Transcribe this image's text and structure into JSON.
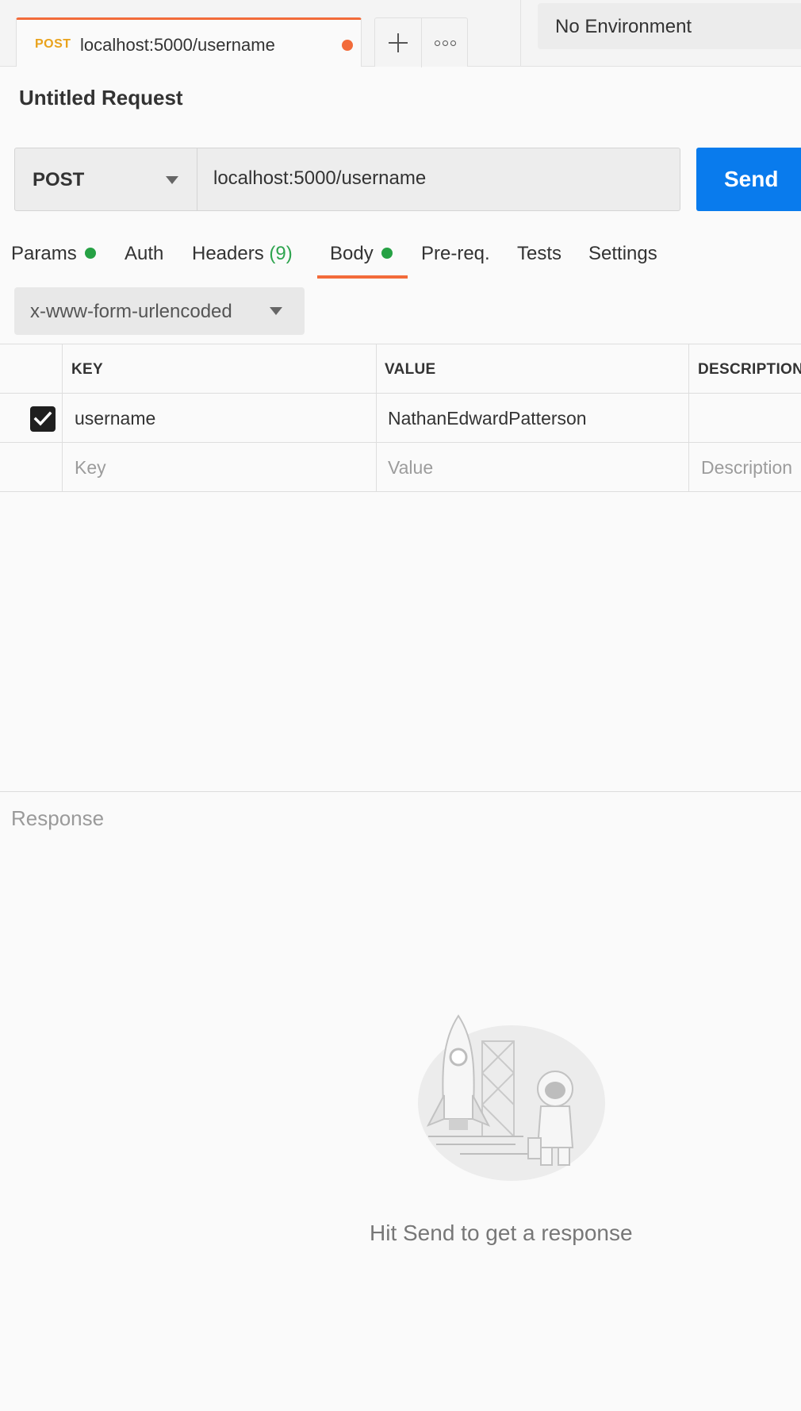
{
  "tab": {
    "method": "POST",
    "url": "localhost:5000/username"
  },
  "environment": {
    "selected": "No Environment"
  },
  "request": {
    "title": "Untitled Request",
    "method": "POST",
    "url": "localhost:5000/username",
    "send_label": "Send"
  },
  "subtabs": [
    {
      "label": "Params",
      "dot": true
    },
    {
      "label": "Auth"
    },
    {
      "label": "Headers",
      "count": "(9)"
    },
    {
      "label": "Body",
      "dot": true,
      "active": true
    },
    {
      "label": "Pre-req."
    },
    {
      "label": "Tests"
    },
    {
      "label": "Settings"
    }
  ],
  "body": {
    "type": "x-www-form-urlencoded",
    "table": {
      "headers": [
        "KEY",
        "VALUE",
        "DESCRIPTION"
      ],
      "rows": [
        {
          "checked": true,
          "key": "username",
          "value": "NathanEdwardPatterson",
          "description": ""
        }
      ],
      "placeholder": {
        "key": "Key",
        "value": "Value",
        "description": "Description"
      }
    }
  },
  "response": {
    "label": "Response",
    "empty_message": "Hit Send to get a response"
  },
  "colors": {
    "accent": "#f26b3a",
    "send": "#097bed",
    "method_tab": "#e9a21c",
    "status_dot": "#26a144"
  }
}
